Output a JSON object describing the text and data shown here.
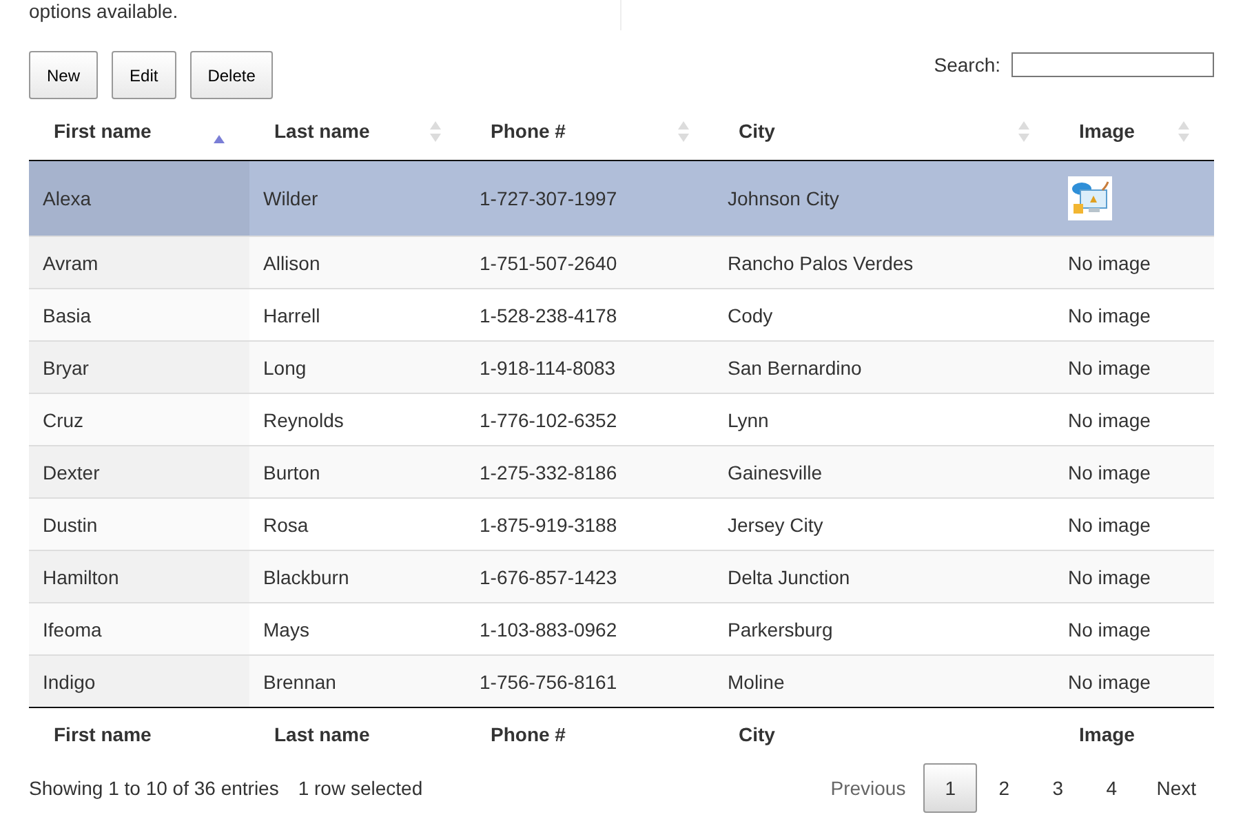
{
  "intro": {
    "text": "options available."
  },
  "buttons": [
    {
      "label": "New",
      "disabled": false
    },
    {
      "label": "Edit",
      "disabled": false
    },
    {
      "label": "Delete",
      "disabled": false
    }
  ],
  "search": {
    "label": "Search:"
  },
  "table": {
    "columns": [
      {
        "label": "First name",
        "sorted": true
      },
      {
        "label": "Last name",
        "sorted": false
      },
      {
        "label": "Phone #",
        "sorted": false
      },
      {
        "label": "City",
        "sorted": false
      },
      {
        "label": "Image",
        "sorted": false
      }
    ],
    "rows": [
      {
        "selected": true,
        "cells": [
          "Alexa",
          "Wilder",
          "1-727-307-1997",
          "Johnson City"
        ],
        "image": {
          "kind": "thumbnail"
        }
      },
      {
        "selected": false,
        "cells": [
          "Avram",
          "Allison",
          "1-751-507-2640",
          "Rancho Palos Verdes"
        ],
        "image": {
          "kind": "text",
          "text": "No image"
        }
      },
      {
        "selected": false,
        "cells": [
          "Basia",
          "Harrell",
          "1-528-238-4178",
          "Cody"
        ],
        "image": {
          "kind": "text",
          "text": "No image"
        }
      },
      {
        "selected": false,
        "cells": [
          "Bryar",
          "Long",
          "1-918-114-8083",
          "San Bernardino"
        ],
        "image": {
          "kind": "text",
          "text": "No image"
        }
      },
      {
        "selected": false,
        "cells": [
          "Cruz",
          "Reynolds",
          "1-776-102-6352",
          "Lynn"
        ],
        "image": {
          "kind": "text",
          "text": "No image"
        }
      },
      {
        "selected": false,
        "cells": [
          "Dexter",
          "Burton",
          "1-275-332-8186",
          "Gainesville"
        ],
        "image": {
          "kind": "text",
          "text": "No image"
        }
      },
      {
        "selected": false,
        "cells": [
          "Dustin",
          "Rosa",
          "1-875-919-3188",
          "Jersey City"
        ],
        "image": {
          "kind": "text",
          "text": "No image"
        }
      },
      {
        "selected": false,
        "cells": [
          "Hamilton",
          "Blackburn",
          "1-676-857-1423",
          "Delta Junction"
        ],
        "image": {
          "kind": "text",
          "text": "No image"
        }
      },
      {
        "selected": false,
        "cells": [
          "Ifeoma",
          "Mays",
          "1-103-883-0962",
          "Parkersburg"
        ],
        "image": {
          "kind": "text",
          "text": "No image"
        }
      },
      {
        "selected": false,
        "cells": [
          "Indigo",
          "Brennan",
          "1-756-756-8161",
          "Moline"
        ],
        "image": {
          "kind": "text",
          "text": "No image"
        }
      }
    ],
    "footer": [
      "First name",
      "Last name",
      "Phone #",
      "City",
      "Image"
    ]
  },
  "info": {
    "entries": "Showing 1 to 10 of 36 entries",
    "selection": "1 row selected"
  },
  "pagination": {
    "previous": {
      "label": "Previous",
      "disabled": true
    },
    "pages": [
      {
        "label": "1",
        "selected": true
      },
      {
        "label": "2",
        "selected": false
      },
      {
        "label": "3",
        "selected": false
      },
      {
        "label": "4",
        "selected": false
      }
    ],
    "next": {
      "label": "Next",
      "disabled": false
    }
  }
}
